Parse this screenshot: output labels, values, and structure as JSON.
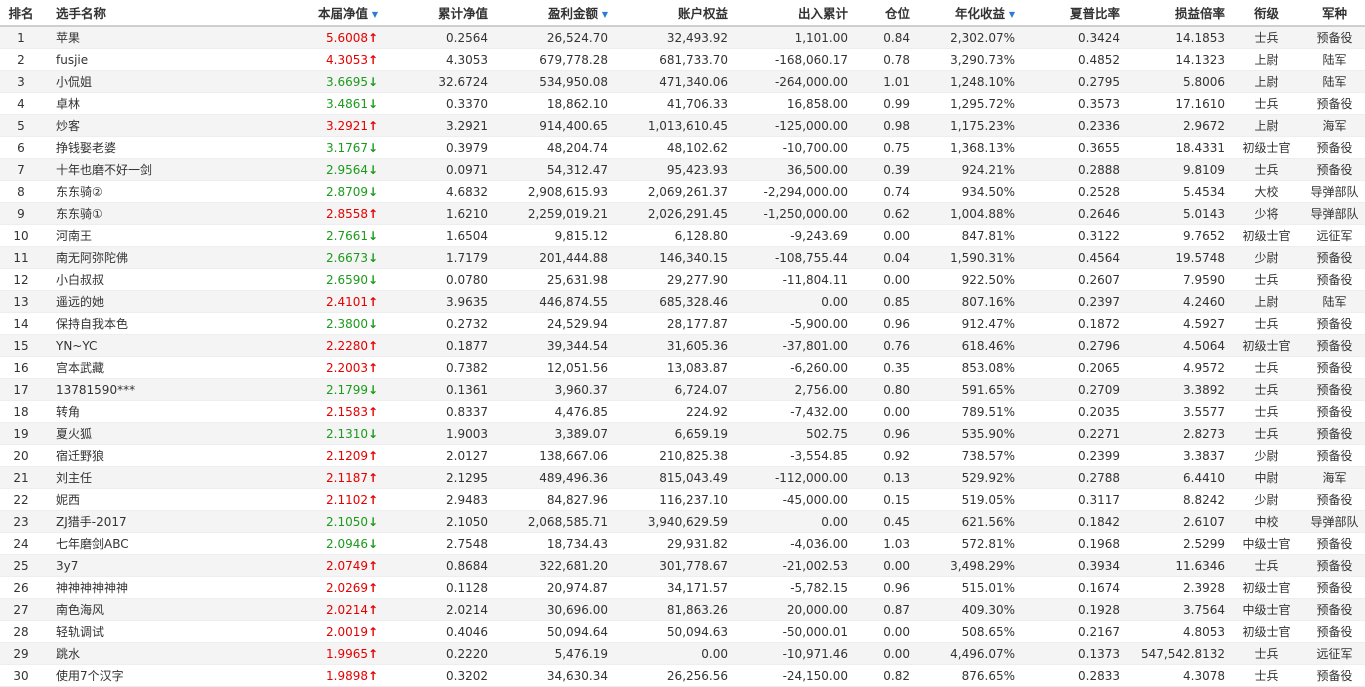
{
  "columns": [
    {
      "key": "rank",
      "label": "排名"
    },
    {
      "key": "name",
      "label": "选手名称"
    },
    {
      "key": "nav",
      "label": "本届净值",
      "sortable": true
    },
    {
      "key": "cum_nav",
      "label": "累计净值"
    },
    {
      "key": "profit",
      "label": "盈利金额",
      "sortable": true
    },
    {
      "key": "equity",
      "label": "账户权益"
    },
    {
      "key": "flow",
      "label": "出入累计"
    },
    {
      "key": "position",
      "label": "仓位"
    },
    {
      "key": "annual",
      "label": "年化收益",
      "sortable": true
    },
    {
      "key": "sharpe",
      "label": "夏普比率"
    },
    {
      "key": "pl_ratio",
      "label": "损益倍率"
    },
    {
      "key": "rank_title",
      "label": "衔级"
    },
    {
      "key": "branch",
      "label": "军种"
    }
  ],
  "trend_colors": {
    "up": "#e60000",
    "down": "#1a9b1a"
  },
  "rows": [
    {
      "rank": "1",
      "name": "苹果",
      "nav": "5.6008",
      "trend": "up",
      "cum_nav": "0.2564",
      "profit": "26,524.70",
      "equity": "32,493.92",
      "flow": "1,101.00",
      "position": "0.84",
      "annual": "2,302.07%",
      "sharpe": "0.3424",
      "pl_ratio": "14.1853",
      "rank_title": "士兵",
      "branch": "预备役"
    },
    {
      "rank": "2",
      "name": "fusjie",
      "nav": "4.3053",
      "trend": "up",
      "cum_nav": "4.3053",
      "profit": "679,778.28",
      "equity": "681,733.70",
      "flow": "-168,060.17",
      "position": "0.78",
      "annual": "3,290.73%",
      "sharpe": "0.4852",
      "pl_ratio": "14.1323",
      "rank_title": "上尉",
      "branch": "陆军"
    },
    {
      "rank": "3",
      "name": "小侃姐",
      "nav": "3.6695",
      "trend": "down",
      "cum_nav": "32.6724",
      "profit": "534,950.08",
      "equity": "471,340.06",
      "flow": "-264,000.00",
      "position": "1.01",
      "annual": "1,248.10%",
      "sharpe": "0.2795",
      "pl_ratio": "5.8006",
      "rank_title": "上尉",
      "branch": "陆军"
    },
    {
      "rank": "4",
      "name": "卓林",
      "nav": "3.4861",
      "trend": "down",
      "cum_nav": "0.3370",
      "profit": "18,862.10",
      "equity": "41,706.33",
      "flow": "16,858.00",
      "position": "0.99",
      "annual": "1,295.72%",
      "sharpe": "0.3573",
      "pl_ratio": "17.1610",
      "rank_title": "士兵",
      "branch": "预备役"
    },
    {
      "rank": "5",
      "name": "炒客",
      "nav": "3.2921",
      "trend": "up",
      "cum_nav": "3.2921",
      "profit": "914,400.65",
      "equity": "1,013,610.45",
      "flow": "-125,000.00",
      "position": "0.98",
      "annual": "1,175.23%",
      "sharpe": "0.2336",
      "pl_ratio": "2.9672",
      "rank_title": "上尉",
      "branch": "海军"
    },
    {
      "rank": "6",
      "name": "挣钱娶老婆",
      "nav": "3.1767",
      "trend": "down",
      "cum_nav": "0.3979",
      "profit": "48,204.74",
      "equity": "48,102.62",
      "flow": "-10,700.00",
      "position": "0.75",
      "annual": "1,368.13%",
      "sharpe": "0.3655",
      "pl_ratio": "18.4331",
      "rank_title": "初级士官",
      "branch": "预备役"
    },
    {
      "rank": "7",
      "name": "十年也磨不好一剑",
      "nav": "2.9564",
      "trend": "down",
      "cum_nav": "0.0971",
      "profit": "54,312.47",
      "equity": "95,423.93",
      "flow": "36,500.00",
      "position": "0.39",
      "annual": "924.21%",
      "sharpe": "0.2888",
      "pl_ratio": "9.8109",
      "rank_title": "士兵",
      "branch": "预备役"
    },
    {
      "rank": "8",
      "name": "东东骑②",
      "nav": "2.8709",
      "trend": "down",
      "cum_nav": "4.6832",
      "profit": "2,908,615.93",
      "equity": "2,069,261.37",
      "flow": "-2,294,000.00",
      "position": "0.74",
      "annual": "934.50%",
      "sharpe": "0.2528",
      "pl_ratio": "5.4534",
      "rank_title": "大校",
      "branch": "导弹部队"
    },
    {
      "rank": "9",
      "name": "东东骑①",
      "nav": "2.8558",
      "trend": "up",
      "cum_nav": "1.6210",
      "profit": "2,259,019.21",
      "equity": "2,026,291.45",
      "flow": "-1,250,000.00",
      "position": "0.62",
      "annual": "1,004.88%",
      "sharpe": "0.2646",
      "pl_ratio": "5.0143",
      "rank_title": "少将",
      "branch": "导弹部队"
    },
    {
      "rank": "10",
      "name": "河南王",
      "nav": "2.7661",
      "trend": "down",
      "cum_nav": "1.6504",
      "profit": "9,815.12",
      "equity": "6,128.80",
      "flow": "-9,243.69",
      "position": "0.00",
      "annual": "847.81%",
      "sharpe": "0.3122",
      "pl_ratio": "9.7652",
      "rank_title": "初级士官",
      "branch": "远征军"
    },
    {
      "rank": "11",
      "name": "南无阿弥陀佛",
      "nav": "2.6673",
      "trend": "down",
      "cum_nav": "1.7179",
      "profit": "201,444.88",
      "equity": "146,340.15",
      "flow": "-108,755.44",
      "position": "0.04",
      "annual": "1,590.31%",
      "sharpe": "0.4564",
      "pl_ratio": "19.5748",
      "rank_title": "少尉",
      "branch": "预备役"
    },
    {
      "rank": "12",
      "name": "小白叔叔",
      "nav": "2.6590",
      "trend": "down",
      "cum_nav": "0.0780",
      "profit": "25,631.98",
      "equity": "29,277.90",
      "flow": "-11,804.11",
      "position": "0.00",
      "annual": "922.50%",
      "sharpe": "0.2607",
      "pl_ratio": "7.9590",
      "rank_title": "士兵",
      "branch": "预备役"
    },
    {
      "rank": "13",
      "name": "遥远的她",
      "nav": "2.4101",
      "trend": "up",
      "cum_nav": "3.9635",
      "profit": "446,874.55",
      "equity": "685,328.46",
      "flow": "0.00",
      "position": "0.85",
      "annual": "807.16%",
      "sharpe": "0.2397",
      "pl_ratio": "4.2460",
      "rank_title": "上尉",
      "branch": "陆军"
    },
    {
      "rank": "14",
      "name": "保持自我本色",
      "nav": "2.3800",
      "trend": "down",
      "cum_nav": "0.2732",
      "profit": "24,529.94",
      "equity": "28,177.87",
      "flow": "-5,900.00",
      "position": "0.96",
      "annual": "912.47%",
      "sharpe": "0.1872",
      "pl_ratio": "4.5927",
      "rank_title": "士兵",
      "branch": "预备役"
    },
    {
      "rank": "15",
      "name": "YN~YC",
      "nav": "2.2280",
      "trend": "up",
      "cum_nav": "0.1877",
      "profit": "39,344.54",
      "equity": "31,605.36",
      "flow": "-37,801.00",
      "position": "0.76",
      "annual": "618.46%",
      "sharpe": "0.2796",
      "pl_ratio": "4.5064",
      "rank_title": "初级士官",
      "branch": "预备役"
    },
    {
      "rank": "16",
      "name": "宫本武藏",
      "nav": "2.2003",
      "trend": "up",
      "cum_nav": "0.7382",
      "profit": "12,051.56",
      "equity": "13,083.87",
      "flow": "-6,260.00",
      "position": "0.35",
      "annual": "853.08%",
      "sharpe": "0.2065",
      "pl_ratio": "4.9572",
      "rank_title": "士兵",
      "branch": "预备役"
    },
    {
      "rank": "17",
      "name": "13781590***",
      "nav": "2.1799",
      "trend": "down",
      "cum_nav": "0.1361",
      "profit": "3,960.37",
      "equity": "6,724.07",
      "flow": "2,756.00",
      "position": "0.80",
      "annual": "591.65%",
      "sharpe": "0.2709",
      "pl_ratio": "3.3892",
      "rank_title": "士兵",
      "branch": "预备役"
    },
    {
      "rank": "18",
      "name": "转角",
      "nav": "2.1583",
      "trend": "up",
      "cum_nav": "0.8337",
      "profit": "4,476.85",
      "equity": "224.92",
      "flow": "-7,432.00",
      "position": "0.00",
      "annual": "789.51%",
      "sharpe": "0.2035",
      "pl_ratio": "3.5577",
      "rank_title": "士兵",
      "branch": "预备役"
    },
    {
      "rank": "19",
      "name": "夏火狐",
      "nav": "2.1310",
      "trend": "down",
      "cum_nav": "1.9003",
      "profit": "3,389.07",
      "equity": "6,659.19",
      "flow": "502.75",
      "position": "0.96",
      "annual": "535.90%",
      "sharpe": "0.2271",
      "pl_ratio": "2.8273",
      "rank_title": "士兵",
      "branch": "预备役"
    },
    {
      "rank": "20",
      "name": "宿迁野狼",
      "nav": "2.1209",
      "trend": "up",
      "cum_nav": "2.0127",
      "profit": "138,667.06",
      "equity": "210,825.38",
      "flow": "-3,554.85",
      "position": "0.92",
      "annual": "738.57%",
      "sharpe": "0.2399",
      "pl_ratio": "3.3837",
      "rank_title": "少尉",
      "branch": "预备役"
    },
    {
      "rank": "21",
      "name": "刘主任",
      "nav": "2.1187",
      "trend": "up",
      "cum_nav": "2.1295",
      "profit": "489,496.36",
      "equity": "815,043.49",
      "flow": "-112,000.00",
      "position": "0.13",
      "annual": "529.92%",
      "sharpe": "0.2788",
      "pl_ratio": "6.4410",
      "rank_title": "中尉",
      "branch": "海军"
    },
    {
      "rank": "22",
      "name": "妮西",
      "nav": "2.1102",
      "trend": "up",
      "cum_nav": "2.9483",
      "profit": "84,827.96",
      "equity": "116,237.10",
      "flow": "-45,000.00",
      "position": "0.15",
      "annual": "519.05%",
      "sharpe": "0.3117",
      "pl_ratio": "8.8242",
      "rank_title": "少尉",
      "branch": "预备役"
    },
    {
      "rank": "23",
      "name": "ZJ猎手-2017",
      "nav": "2.1050",
      "trend": "down",
      "cum_nav": "2.1050",
      "profit": "2,068,585.71",
      "equity": "3,940,629.59",
      "flow": "0.00",
      "position": "0.45",
      "annual": "621.56%",
      "sharpe": "0.1842",
      "pl_ratio": "2.6107",
      "rank_title": "中校",
      "branch": "导弹部队"
    },
    {
      "rank": "24",
      "name": "七年磨剑ABC",
      "nav": "2.0946",
      "trend": "down",
      "cum_nav": "2.7548",
      "profit": "18,734.43",
      "equity": "29,931.82",
      "flow": "-4,036.00",
      "position": "1.03",
      "annual": "572.81%",
      "sharpe": "0.1968",
      "pl_ratio": "2.5299",
      "rank_title": "中级士官",
      "branch": "预备役"
    },
    {
      "rank": "25",
      "name": "3y7",
      "nav": "2.0749",
      "trend": "up",
      "cum_nav": "0.8684",
      "profit": "322,681.20",
      "equity": "301,778.67",
      "flow": "-21,002.53",
      "position": "0.00",
      "annual": "3,498.29%",
      "sharpe": "0.3934",
      "pl_ratio": "11.6346",
      "rank_title": "士兵",
      "branch": "预备役"
    },
    {
      "rank": "26",
      "name": "神神神神神神",
      "nav": "2.0269",
      "trend": "up",
      "cum_nav": "0.1128",
      "profit": "20,974.87",
      "equity": "34,171.57",
      "flow": "-5,782.15",
      "position": "0.96",
      "annual": "515.01%",
      "sharpe": "0.1674",
      "pl_ratio": "2.3928",
      "rank_title": "初级士官",
      "branch": "预备役"
    },
    {
      "rank": "27",
      "name": "南色海风",
      "nav": "2.0214",
      "trend": "up",
      "cum_nav": "2.0214",
      "profit": "30,696.00",
      "equity": "81,863.26",
      "flow": "20,000.00",
      "position": "0.87",
      "annual": "409.30%",
      "sharpe": "0.1928",
      "pl_ratio": "3.7564",
      "rank_title": "中级士官",
      "branch": "预备役"
    },
    {
      "rank": "28",
      "name": "轻轨调试",
      "nav": "2.0019",
      "trend": "up",
      "cum_nav": "0.4046",
      "profit": "50,094.64",
      "equity": "50,094.63",
      "flow": "-50,000.01",
      "position": "0.00",
      "annual": "508.65%",
      "sharpe": "0.2167",
      "pl_ratio": "4.8053",
      "rank_title": "初级士官",
      "branch": "预备役"
    },
    {
      "rank": "29",
      "name": "跳水",
      "nav": "1.9965",
      "trend": "up",
      "cum_nav": "0.2220",
      "profit": "5,476.19",
      "equity": "0.00",
      "flow": "-10,971.46",
      "position": "0.00",
      "annual": "4,496.07%",
      "sharpe": "0.1373",
      "pl_ratio": "547,542.8132",
      "rank_title": "士兵",
      "branch": "远征军"
    },
    {
      "rank": "30",
      "name": "使用7个汉字",
      "nav": "1.9898",
      "trend": "up",
      "cum_nav": "0.3202",
      "profit": "34,630.34",
      "equity": "26,256.56",
      "flow": "-24,150.00",
      "position": "0.82",
      "annual": "876.65%",
      "sharpe": "0.2833",
      "pl_ratio": "4.3078",
      "rank_title": "士兵",
      "branch": "预备役"
    }
  ]
}
